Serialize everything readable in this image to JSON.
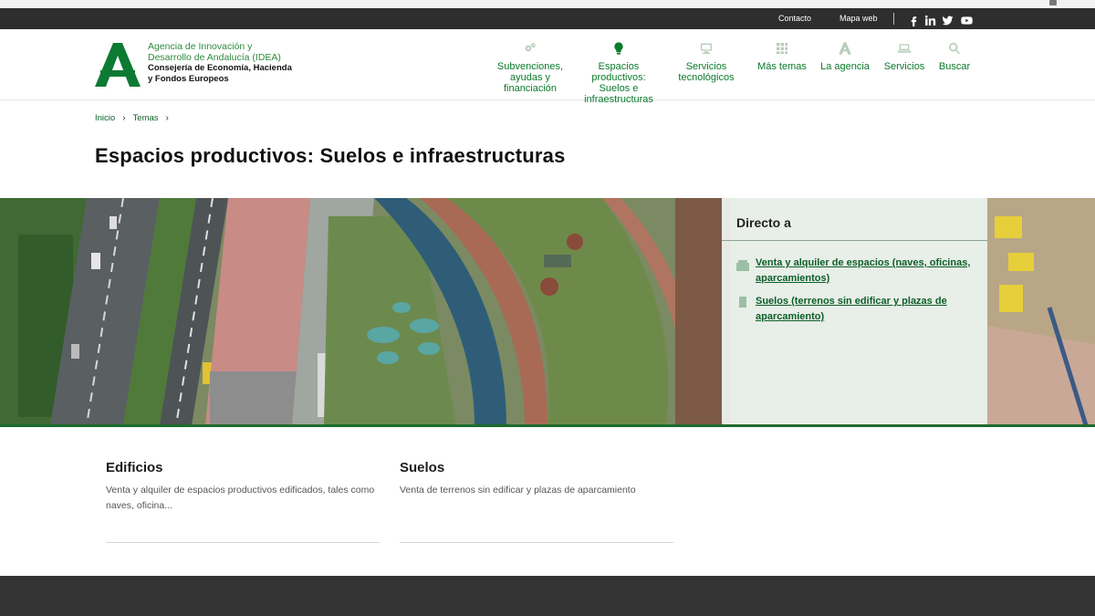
{
  "utility": {
    "contact": "Contacto",
    "sitemap": "Mapa web",
    "social": [
      "facebook-icon",
      "linkedin-icon",
      "twitter-icon",
      "youtube-icon"
    ]
  },
  "logo": {
    "line1": "Agencia de Innovación y",
    "line2": "Desarrollo de Andalucía (IDEA)",
    "line3": "Consejería de Economía, Hacienda",
    "line4": "y Fondos Europeos"
  },
  "nav": [
    {
      "icon": "gears-icon",
      "lines": [
        "Subvenciones,",
        "ayudas y",
        "financiación"
      ]
    },
    {
      "icon": "lightbulb-icon",
      "lines": [
        "Espacios",
        "productivos:",
        "Suelos e",
        "infraestructuras"
      ],
      "active": true
    },
    {
      "icon": "monitor-icon",
      "lines": [
        "Servicios",
        "tecnológicos"
      ]
    },
    {
      "icon": "grid-icon",
      "lines": [
        "Más temas"
      ]
    },
    {
      "icon": "andalucia-a-icon",
      "lines": [
        "La agencia"
      ]
    },
    {
      "icon": "laptop-icon",
      "lines": [
        "Servicios"
      ]
    },
    {
      "icon": "search-icon",
      "lines": [
        "Buscar"
      ]
    }
  ],
  "breadcrumb": [
    "Inicio",
    "Temas"
  ],
  "page_title": "Espacios productivos: Suelos e infraestructuras",
  "direct": {
    "title": "Directo a",
    "links": [
      {
        "text": "Venta y alquiler de espacios (naves, oficinas, aparcamientos)",
        "icon": "building-icon"
      },
      {
        "text": "Suelos (terrenos sin edificar y plazas de aparcamiento)",
        "icon": "land-icon"
      }
    ]
  },
  "cards": [
    {
      "title": "Edificios",
      "desc": "Venta y alquiler de espacios productivos edificados, tales como naves, oficina..."
    },
    {
      "title": "Suelos",
      "desc": "Venta de terrenos sin edificar y plazas de aparcamiento"
    }
  ],
  "colors": {
    "brand_green": "#0b7a2c",
    "dark_bar": "#2e2e2e",
    "accent_border": "#1d6b2c"
  }
}
